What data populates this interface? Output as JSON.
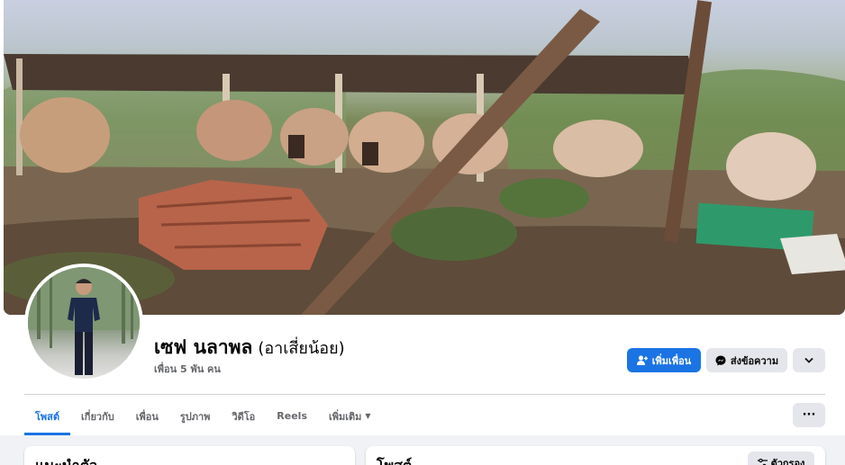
{
  "profile": {
    "name": "เซฟ นลาพล",
    "nickname": "(อาเสี่ยน้อย)",
    "friends": "เพื่อน 5 พัน คน"
  },
  "actions": {
    "add_friend": "เพิ่มเพื่อน",
    "message": "ส่งข้อความ"
  },
  "tabs": [
    {
      "label": "โพสต์",
      "active": true
    },
    {
      "label": "เกี่ยวกับ"
    },
    {
      "label": "เพื่อน"
    },
    {
      "label": "รูปภาพ"
    },
    {
      "label": "วิดีโอ"
    },
    {
      "label": "Reels"
    },
    {
      "label": "เพิ่มเติม"
    }
  ],
  "cards": {
    "intro_title": "แนะนำตัว",
    "posts_title": "โพสต์",
    "filter_label": "ตัวกรอง"
  },
  "colors": {
    "accent": "#1b74e4",
    "secondary_button": "#e4e6eb",
    "page_background": "#f0f2f5"
  }
}
